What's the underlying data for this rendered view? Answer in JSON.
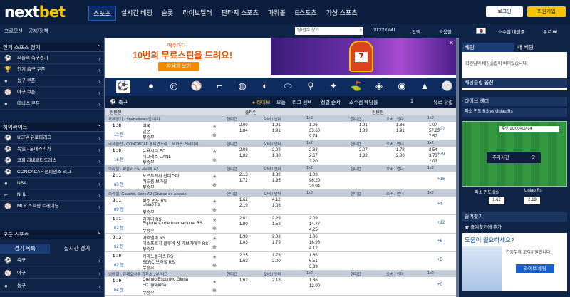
{
  "app": {
    "logo_a": "next",
    "logo_b": "bet"
  },
  "nav": [
    "스포츠",
    "실시간 베팅",
    "슬롯",
    "라이브딜러",
    "판타지 스포츠",
    "파워볼",
    "E스포츠",
    "가상 스포츠"
  ],
  "header": {
    "login": "로그인",
    "join": "회원가입"
  },
  "subbar": {
    "promo": "프로모션",
    "notice": "공제/정책",
    "search_placeholder": "팀/선수 찾기",
    "time": "00:22 GMT",
    "wallet": "잔액",
    "help": "도움말",
    "odds": "소수점 배당률",
    "currency": "유로 ₩"
  },
  "left": {
    "popular": {
      "title": "인기 스포츠 경기",
      "items": [
        "오늘의 축구경기",
        "인기 축구 쿠폰",
        "농구 쿠폰",
        "야구 쿠폰",
        "테니스 쿠폰"
      ]
    },
    "highlights": {
      "title": "하이라이트",
      "items": [
        "UEFA 유로파리그",
        "독일 - 분데스리가",
        "코파 리베르타도레스",
        "CONCACAF 챔피언스 리그",
        "NBA",
        "NHL",
        "MLB 스프링 트레이닝"
      ]
    },
    "all": {
      "title": "모든 스포츠",
      "tab1": "경기 목록",
      "tab2": "실시간 경기",
      "items": [
        "축구",
        "야구",
        "농구"
      ]
    }
  },
  "banner": {
    "line1": "매주마다",
    "line2": "10번의 무료스핀을 드려요!",
    "button": "자세히 보기"
  },
  "sport_header": {
    "name": "축구",
    "live": "● 라이브",
    "today": "오늘",
    "league": "리그 선택",
    "sort": "정렬 순서",
    "odds_type": "소수점 배당률",
    "page": "1",
    "market": "유로 유럽"
  },
  "columns": {
    "all": "전반전",
    "full": "풀타임",
    "half": "전반전",
    "handicap": "핸디캡",
    "ou": "오버 / 언더",
    "x12": "1x2"
  },
  "leagues": [
    {
      "name": "국제경기 - SheBelieves컵 여자",
      "rows": [
        {
          "score": "1 : 0",
          "time": "13 분",
          "t1": "미국",
          "t2": "일본",
          "t3": "무승부",
          "h1": "2.00",
          "h2": "1.84",
          "o1": "1.91",
          "o2": "1.91",
          "x1": "1.06",
          "x2": "33.60",
          "x3": "9.74",
          "hh1": "1.91",
          "hh2": "1.89",
          "ho1": "1.86",
          "ho2": "1.91",
          "hx1": "1.07",
          "hx2": "57.23",
          "hx3": "7.57",
          "more": "+27"
        }
      ]
    },
    {
      "name": "국제클럽 - CONCACAF 챔피언스리그 넉아웃 스테이지",
      "rows": [
        {
          "score": "1 : 0",
          "time": "16 분",
          "t1": "뉴욕시티 FC",
          "t2": "티그레스 UANL",
          "t3": "무승부",
          "h1": "2.08",
          "h2": "1.82",
          "o1": "2.08",
          "o2": "1.80",
          "x1": "2.68",
          "x2": "2.67",
          "x3": "3.20",
          "hh1": "2.07",
          "hh2": "1.82",
          "ho1": "1.78",
          "ho2": "2.00",
          "hx1": "3.54",
          "hx2": "3.73",
          "hx3": "2.03",
          "more": "+79"
        }
      ]
    },
    {
      "name": "브라질 - 파울리스타 세리에 A2",
      "rows": [
        {
          "score": "2 : 1",
          "time": "60 분",
          "t1": "포르투게사 산티스타",
          "t2": "러드롱 브라질",
          "t3": "무승부",
          "h1": "2.13",
          "h2": "1.72",
          "o1": "1.82",
          "o2": "1.95",
          "x1": "1.03",
          "x2": "96.20",
          "x3": "29.94",
          "hh1": "",
          "hh2": "",
          "ho1": "",
          "ho2": "",
          "hx1": "",
          "hx2": "",
          "hx3": "",
          "more": "+16"
        }
      ]
    },
    {
      "name": "브라질, Gaucho, Serie A2 (Divisao de Acesso)",
      "rows": [
        {
          "score": "0 : 1",
          "time": "89 분",
          "t1": "파소 펀도 RS",
          "t2": "Uniao Rs",
          "t3": "무승부",
          "h1": "1.62",
          "h2": "2.19",
          "o1": "4.12",
          "o2": "1.08",
          "x1": "",
          "x2": "",
          "x3": "",
          "more": "+4"
        },
        {
          "score": "1 : 1",
          "time": "62 분",
          "t1": "과라니 RS",
          "t2": "Esporte Clube Internacional RS",
          "t3": "무승부",
          "h1": "2.01",
          "h2": "1.80",
          "o1": "2.29",
          "o2": "1.52",
          "x1": "2.09",
          "x2": "14.77",
          "x3": "4.25",
          "more": "+12"
        },
        {
          "score": "0 : 3",
          "time": "62 분",
          "t1": "아제엔비 RS",
          "t2": "이스포르치 클루비 상 가브리에우 RS",
          "t3": "무승부",
          "h1": "1.98",
          "h2": "1.83",
          "o1": "2.03",
          "o2": "1.79",
          "x1": "1.06",
          "x2": "16.96",
          "x3": "4.12",
          "more": "+6"
        },
        {
          "score": "1 : 0",
          "time": "62 분",
          "t1": "케라노폴리스 RS",
          "t2": "SERC 브라질 RS",
          "t3": "무승부",
          "h1": "2.25",
          "h2": "1.63",
          "o1": "1.78",
          "o2": "2.00",
          "x1": "1.65",
          "x2": "6.51",
          "x3": "3.39",
          "more": "+5"
        }
      ]
    },
    {
      "name": "브라질 - 캄페오나투 가우초 2부 리그",
      "rows": [
        {
          "score": "1 : 0",
          "time": "64 분",
          "t1": "Gremio Esportivo Gloria",
          "t2": "EC Igrejinha",
          "t3": "무승부",
          "h1": "1.62",
          "h2": "",
          "o1": "2.18",
          "o2": "",
          "x1": "1.36",
          "x2": "12.00",
          "x3": "",
          "more": "+0"
        }
      ]
    }
  ],
  "right": {
    "tab1": "베팅",
    "tab2": "내 베팅",
    "empty": "회원님의 베팅슬립이 비어있습니다.",
    "settings": "베팅슬립 옵션",
    "live_center": "라이브 센터",
    "match": "파소 펀도 RS vs Uniao Rs",
    "field_label": "추가시간",
    "field_min": "5'",
    "time_box": "후반 90:00+00:14",
    "team1": "파소 펀도 RS",
    "team2": "Uniao Rs",
    "odd1": "1.62",
    "odd2": "2.19",
    "fav": "즐겨찾기",
    "fav_add": "★ 즐겨찾기에 추가",
    "help_title": "도움이 필요하세요?",
    "help_text": "연중무휴 고객지원합니다.",
    "chat": "라이브 채팅"
  }
}
